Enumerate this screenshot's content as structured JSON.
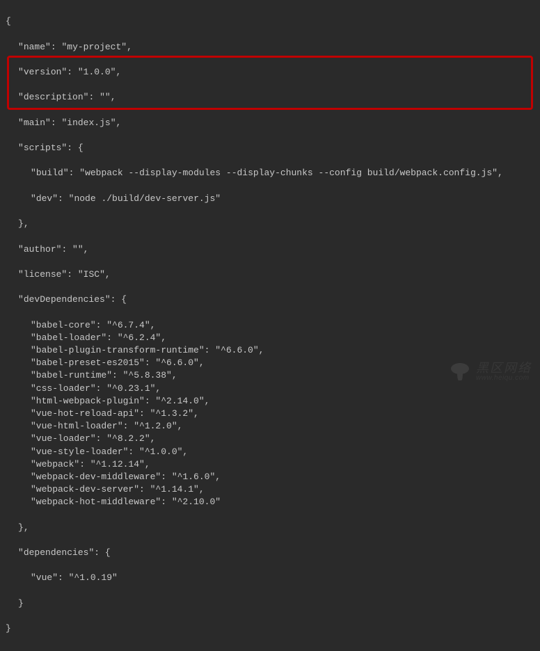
{
  "open_brace": "{",
  "close_brace": "}",
  "comma": ",",
  "colon": ": ",
  "quote": "\"",
  "block_open": "{",
  "block_close": "}",
  "pkg": {
    "name_key": "name",
    "name_val": "my-project",
    "version_key": "version",
    "version_val": "1.0.0",
    "description_key": "description",
    "description_val": "",
    "main_key": "main",
    "main_val": "index.js",
    "scripts_key": "scripts",
    "scripts": {
      "build_key": "build",
      "build_val": "webpack --display-modules --display-chunks --config build/webpack.config.js",
      "dev_key": "dev",
      "dev_val": "node ./build/dev-server.js"
    },
    "author_key": "author",
    "author_val": "",
    "license_key": "license",
    "license_val": "ISC",
    "devdeps_key": "devDependencies",
    "devdeps": [
      {
        "k": "babel-core",
        "v": "^6.7.4"
      },
      {
        "k": "babel-loader",
        "v": "^6.2.4"
      },
      {
        "k": "babel-plugin-transform-runtime",
        "v": "^6.6.0"
      },
      {
        "k": "babel-preset-es2015",
        "v": "^6.6.0"
      },
      {
        "k": "babel-runtime",
        "v": "^5.8.38"
      },
      {
        "k": "css-loader",
        "v": "^0.23.1"
      },
      {
        "k": "html-webpack-plugin",
        "v": "^2.14.0"
      },
      {
        "k": "vue-hot-reload-api",
        "v": "^1.3.2"
      },
      {
        "k": "vue-html-loader",
        "v": "^1.2.0"
      },
      {
        "k": "vue-loader",
        "v": "^8.2.2"
      },
      {
        "k": "vue-style-loader",
        "v": "^1.0.0"
      },
      {
        "k": "webpack",
        "v": "^1.12.14"
      },
      {
        "k": "webpack-dev-middleware",
        "v": "^1.6.0"
      },
      {
        "k": "webpack-dev-server",
        "v": "^1.14.1"
      },
      {
        "k": "webpack-hot-middleware",
        "v": "^2.10.0"
      }
    ],
    "deps_key": "dependencies",
    "deps": [
      {
        "k": "vue",
        "v": "^1.0.19"
      }
    ]
  },
  "watermark": {
    "title": "黑区网络",
    "url": "www.heiqu.com"
  }
}
